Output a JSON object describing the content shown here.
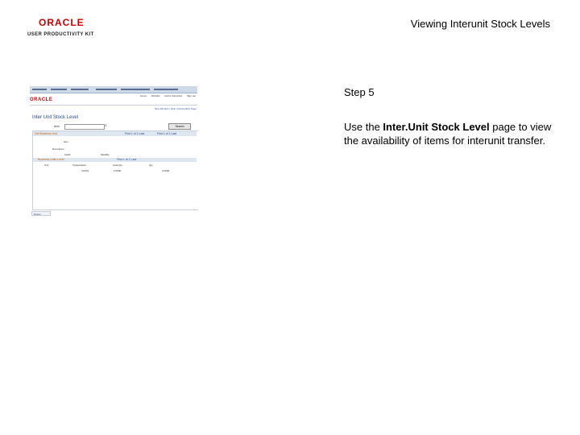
{
  "header": {
    "logo_brand": "ORACLE",
    "logo_product": "USER PRODUCTIVITY KIT",
    "title": "Viewing Interunit Stock Levels"
  },
  "screenshot": {
    "brand": "ORACLE",
    "top_links": [
      "Home",
      "Worklist",
      "Add to Favorites",
      "Sign out"
    ],
    "page_links": [
      "New Window",
      "Help",
      "Personalize Page"
    ],
    "page_title": "Inter Unit Stock Level",
    "item_label": "Item",
    "search_button": "Search",
    "section_label": "Get Business Unit",
    "nav_text_1": "First 1 of 1 Last",
    "nav_text_2": "First 1 of 1 Last",
    "nav_text_3": "First 1 of 1 Last",
    "row_labels": [
      "Item",
      "Description",
      "SetID"
    ],
    "setid_value": "SHARE",
    "bu_section_label": "Business Units Level",
    "col_headers": [
      "Unit",
      "Organization",
      "Avail Qty",
      "Qty"
    ],
    "row_values": [
      "US001",
      "0.0000",
      "0.0000"
    ],
    "return_button": "Return"
  },
  "instructions": {
    "step": "Step 5",
    "text_before": "Use the ",
    "text_bold": "Inter.Unit Stock Level",
    "text_after": " page to view the availability of items for interunit transfer."
  }
}
